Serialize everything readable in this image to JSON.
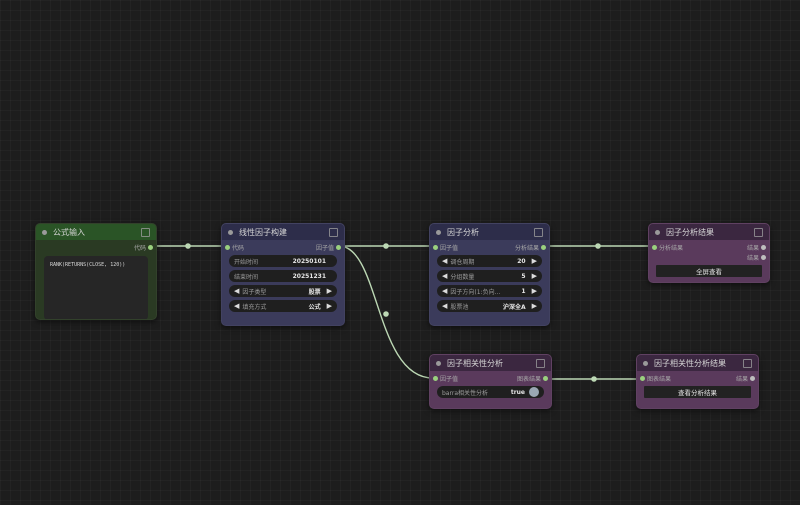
{
  "colors": {
    "canvas": "#1d1d1d",
    "wire": "#bcd8b4",
    "port": "#9ad07e"
  },
  "nodes": {
    "formula_input": {
      "title": "公式输入",
      "output": "代码",
      "formula_text": "RANK(RETURNS(CLOSE, 120))"
    },
    "linear_factor": {
      "title": "线性因子构建",
      "input": "代码",
      "output": "因子值",
      "widgets": [
        {
          "label": "开始时间",
          "value": "20250101"
        },
        {
          "label": "结束时间",
          "value": "20251231"
        },
        {
          "label": "因子类型",
          "value": "股票"
        },
        {
          "label": "填充方式",
          "value": "公式"
        }
      ]
    },
    "factor_analysis": {
      "title": "因子分析",
      "input": "因子值",
      "output": "分析结果",
      "widgets": [
        {
          "label": "调仓周期",
          "value": "20"
        },
        {
          "label": "分组数量",
          "value": "5"
        },
        {
          "label": "因子方向(1:负向...",
          "value": "1"
        },
        {
          "label": "股票池",
          "value": "沪深全A"
        }
      ]
    },
    "factor_result": {
      "title": "因子分析结果",
      "input": "分析结果",
      "outputs": [
        "结果",
        "结果"
      ],
      "button": "全屏查看"
    },
    "correlation": {
      "title": "因子相关性分析",
      "input": "因子值",
      "output": "图表结果",
      "toggle": {
        "label": "barra相关性分析",
        "value": "true"
      }
    },
    "correlation_result": {
      "title": "因子相关性分析结果",
      "input": "图表结果",
      "output": "结果",
      "button": "查看分析结果"
    }
  }
}
